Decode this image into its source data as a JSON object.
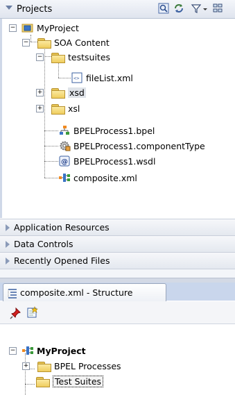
{
  "projects_panel": {
    "title": "Projects",
    "tree": {
      "root": "MyProject",
      "soa_content": "SOA Content",
      "testsuites": "testsuites",
      "filelist": "fileList.xml",
      "xsd": "xsd",
      "xsl": "xsl",
      "bpel": "BPELProcess1.bpel",
      "component_type": "BPELProcess1.componentType",
      "wsdl": "BPELProcess1.wsdl",
      "composite": "composite.xml"
    }
  },
  "accordion": {
    "app_resources": "Application Resources",
    "data_controls": "Data Controls",
    "recent_files": "Recently Opened Files"
  },
  "structure_panel": {
    "tab_title": "composite.xml - Structure",
    "tree": {
      "root": "MyProject",
      "bpel_processes": "BPEL Processes",
      "test_suites": "Test Suites"
    }
  },
  "colors": {
    "header_bg": "#dfe4ee",
    "selection_bg": "#dfe3e9",
    "tabbar_bg": "#c9d6ec",
    "folder_yellow": "#efcd5e"
  }
}
